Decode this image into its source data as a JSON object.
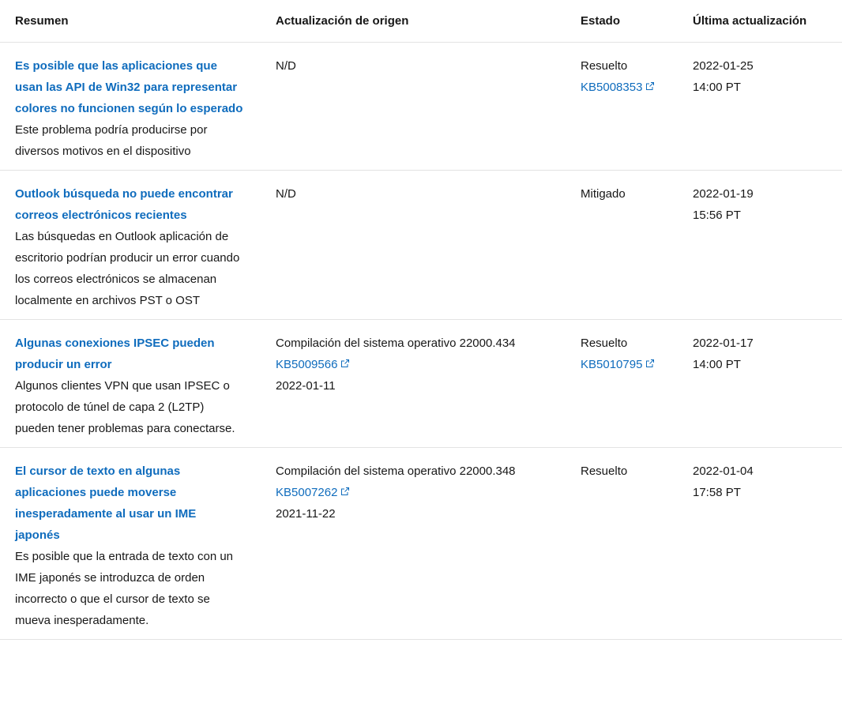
{
  "headers": {
    "summary": "Resumen",
    "origin": "Actualización de origen",
    "status": "Estado",
    "last_update": "Última actualización"
  },
  "rows": [
    {
      "title": "Es posible que las aplicaciones que usan las API de Win32 para representar colores no funcionen según lo esperado",
      "description": "Este problema podría producirse por diversos motivos en el dispositivo",
      "origin": "N/D",
      "origin_kb": "",
      "origin_date": "",
      "status": "Resuelto",
      "status_kb": "KB5008353",
      "date": "2022-01-25",
      "time": "14:00 PT"
    },
    {
      "title": "Outlook búsqueda no puede encontrar correos electrónicos recientes",
      "description": "Las búsquedas en Outlook aplicación de escritorio podrían producir un error cuando los correos electrónicos se almacenan localmente en archivos PST o OST",
      "origin": "N/D",
      "origin_kb": "",
      "origin_date": "",
      "status": "Mitigado",
      "status_kb": "",
      "date": "2022-01-19",
      "time": "15:56 PT"
    },
    {
      "title": "Algunas conexiones IPSEC pueden producir un error",
      "description": "Algunos clientes VPN que usan IPSEC o protocolo de túnel de capa 2 (L2TP) pueden tener problemas para conectarse.",
      "origin": "Compilación del sistema operativo 22000.434",
      "origin_kb": "KB5009566",
      "origin_date": "2022-01-11",
      "status": "Resuelto",
      "status_kb": "KB5010795",
      "date": "2022-01-17",
      "time": "14:00 PT"
    },
    {
      "title": "El cursor de texto en algunas aplicaciones puede moverse inesperadamente al usar un IME japonés",
      "description": "Es posible que la entrada de texto con un IME japonés se introduzca de orden incorrecto o que el cursor de texto se mueva inesperadamente.",
      "origin": "Compilación del sistema operativo 22000.348",
      "origin_kb": "KB5007262",
      "origin_date": "2021-11-22",
      "status": "Resuelto",
      "status_kb": "",
      "date": "2022-01-04",
      "time": "17:58 PT"
    }
  ],
  "colors": {
    "link": "#0f6cbd",
    "text": "#171717",
    "border": "#e3e3e3"
  },
  "icons": {
    "external_link": "external-link-icon"
  }
}
